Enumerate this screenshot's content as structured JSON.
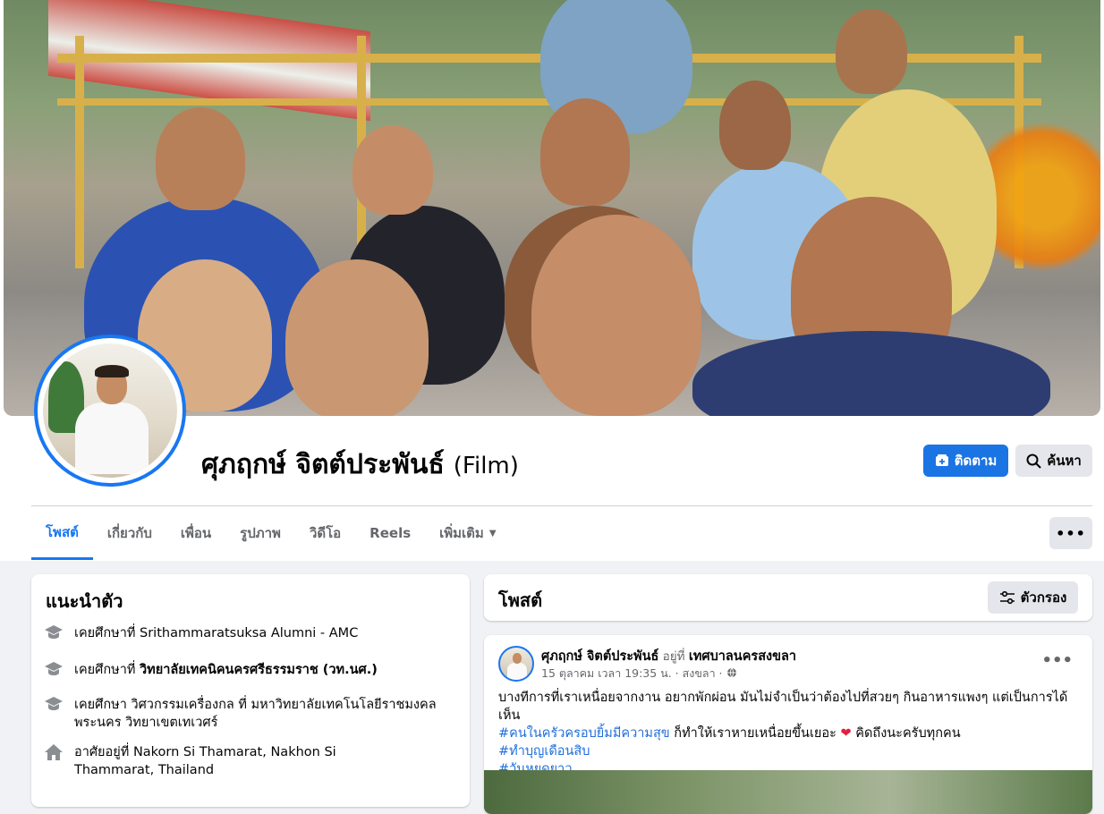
{
  "profile": {
    "name": "ศุภฤกษ์ จิตต์ประพันธ์",
    "alt_name": "(Film)",
    "follow_label": "ติดตาม",
    "search_label": "ค้นหา",
    "more_label": "•••"
  },
  "tabs": [
    {
      "label": "โพสต์",
      "active": true
    },
    {
      "label": "เกี่ยวกับ",
      "active": false
    },
    {
      "label": "เพื่อน",
      "active": false
    },
    {
      "label": "รูปภาพ",
      "active": false
    },
    {
      "label": "วิดีโอ",
      "active": false
    },
    {
      "label": "Reels",
      "active": false
    },
    {
      "label": "เพิ่มเติม",
      "active": false
    }
  ],
  "intro": {
    "title": "แนะนำตัว",
    "items": [
      {
        "icon": "graduation-cap-icon",
        "prefix": "เคยศึกษาที่ ",
        "value": "Srithammaratsuksa Alumni - AMC",
        "value_bold": false
      },
      {
        "icon": "graduation-cap-icon",
        "prefix": "เคยศึกษาที่ ",
        "value": "วิทยาลัยเทคนิคนครศรีธรรมราช (วท.นศ.)",
        "value_bold": true
      },
      {
        "icon": "graduation-cap-icon",
        "prefix": "เคยศึกษา ",
        "value": "วิศวกรรมเครื่องกล ที่ มหาวิทยาลัยเทคโนโลยีราชมงคลพระนคร วิทยาเขตเทเวศร์",
        "value_bold": false
      },
      {
        "icon": "home-icon",
        "prefix": "อาศัยอยู่ที่ ",
        "value": "Nakorn Si Thamarat, Nakhon Si Thammarat, Thailand",
        "value_bold": false
      }
    ]
  },
  "posts_header": {
    "title": "โพสต์",
    "filter_label": "ตัวกรอง"
  },
  "post": {
    "author": "ศุภฤกษ์ จิตต์ประพันธ์",
    "at_label": " อยู่ที่ ",
    "location": "เทศบาลนครสงขลา",
    "meta": "15 ตุลาคม เวลา 19:35 น. · สงขลา ·",
    "line1": "บางทีการที่เราเหนื่อยจากงาน อยากพักผ่อน มันไม่จำเป็นว่าต้องไปที่สวยๆ กินอาหารแพงๆ แต่เป็นการได้เห็น",
    "hashtag1": "#คนในครัวครอบยิ้มมีความสุข",
    "line2_rest": " ก็ทำให้เราหายเหนื่อยขึ้นเยอะ ",
    "line2_tail": " คิดถึงนะครับทุกคน",
    "hashtag2": "#ทำบุญเดือนสิบ",
    "hashtag3": "#วันหยุดยาว"
  }
}
